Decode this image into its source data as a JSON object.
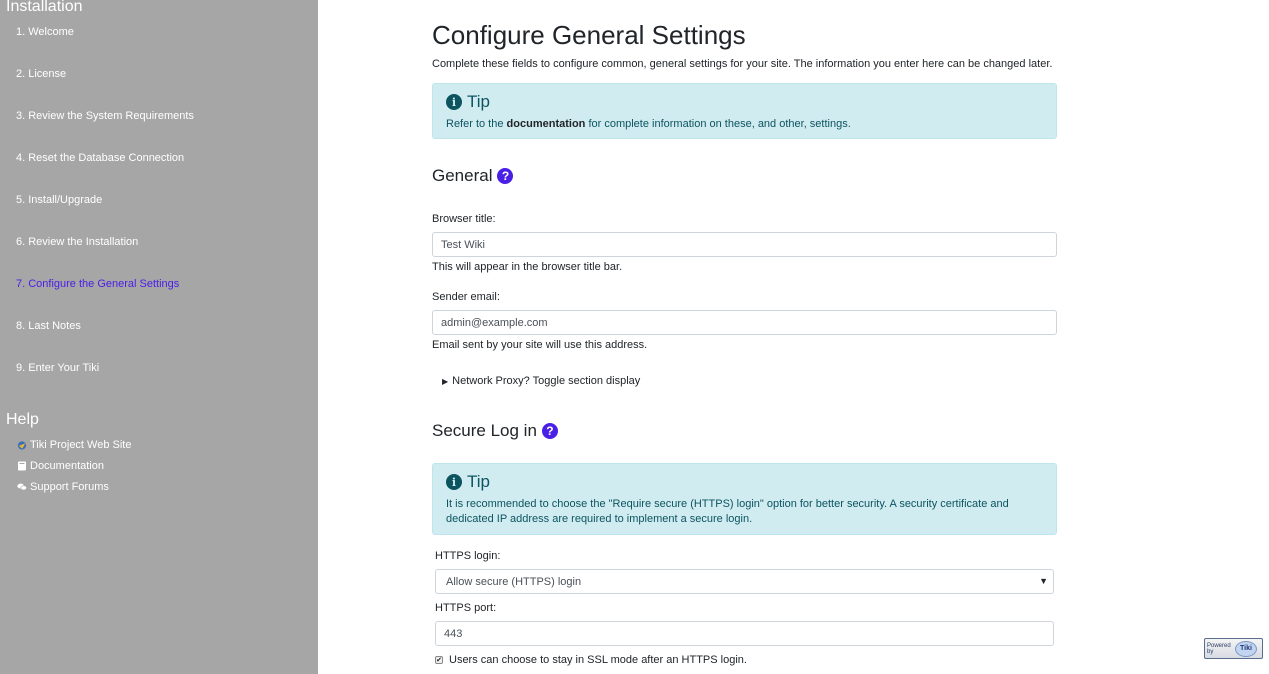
{
  "sidebar": {
    "installation_heading": "Installation",
    "steps": [
      {
        "label": "1. Welcome"
      },
      {
        "label": "2. License"
      },
      {
        "label": "3. Review the System Requirements"
      },
      {
        "label": "4. Reset the Database Connection"
      },
      {
        "label": "5. Install/Upgrade"
      },
      {
        "label": "6. Review the Installation"
      },
      {
        "label": "7. Configure the General Settings",
        "active": true
      },
      {
        "label": "8. Last Notes"
      },
      {
        "label": "9. Enter Your Tiki"
      }
    ],
    "help_heading": "Help",
    "help_links": [
      {
        "label": "Tiki Project Web Site",
        "icon": "tiki-logo-icon"
      },
      {
        "label": "Documentation",
        "icon": "book-icon"
      },
      {
        "label": "Support Forums",
        "icon": "comments-icon"
      }
    ],
    "colors": {
      "background": "#a6a6a6",
      "active": "#4a1fe6"
    }
  },
  "main": {
    "title": "Configure General Settings",
    "intro": "Complete these fields to configure common, general settings for your site. The information you enter here can be changed later.",
    "tip1": {
      "title": "Tip",
      "text_before": "Refer to the ",
      "link": "documentation",
      "text_after": " for complete information on these, and other, settings."
    },
    "general": {
      "heading": "General",
      "browser_title_label": "Browser title:",
      "browser_title_value": "Test Wiki",
      "browser_title_help": "This will appear in the browser title bar.",
      "sender_email_label": "Sender email:",
      "sender_email_value": "admin@example.com",
      "sender_email_help": "Email sent by your site will use this address.",
      "proxy_toggle": "Network Proxy? Toggle section display"
    },
    "secure": {
      "heading": "Secure Log in",
      "tip_title": "Tip",
      "tip_text": "It is recommended to choose the \"Require secure (HTTPS) login\" option for better security. A security certificate and dedicated IP address are required to implement a secure login.",
      "https_login_label": "HTTPS login:",
      "https_login_value": "Allow secure (HTTPS) login",
      "https_port_label": "HTTPS port:",
      "https_port_value": "443",
      "ssl_checkbox_label": "Users can choose to stay in SSL mode after an HTTPS login.",
      "ssl_checked": true
    }
  },
  "powered": {
    "text": "Powered by",
    "logo": "Tiki"
  },
  "colors": {
    "tip_bg": "#d1ecf1",
    "tip_text": "#0c5460",
    "help_icon": "#4a1fe6"
  }
}
